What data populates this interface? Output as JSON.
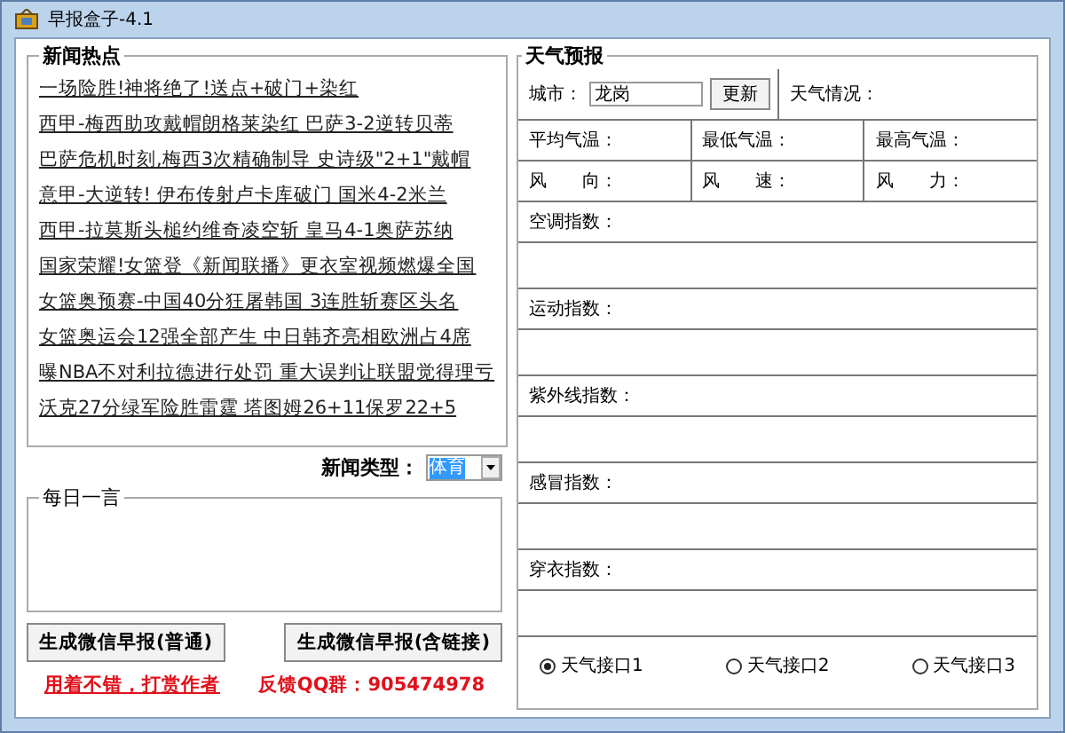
{
  "window": {
    "title": "早报盒子-4.1"
  },
  "news": {
    "title": "新闻热点",
    "items": [
      "一场险胜!神将绝了!送点+破门+染红",
      "西甲-梅西助攻戴帽朗格莱染红 巴萨3-2逆转贝蒂",
      "巴萨危机时刻,梅西3次精确制导 史诗级\"2+1\"戴帽",
      "意甲-大逆转! 伊布传射卢卡库破门 国米4-2米兰",
      "西甲-拉莫斯头槌约维奇凌空斩 皇马4-1奥萨苏纳",
      "国家荣耀!女篮登《新闻联播》更衣室视频燃爆全国",
      "女篮奥预赛-中国40分狂屠韩国 3连胜斩赛区头名",
      "女篮奥运会12强全部产生 中日韩齐亮相欧洲占4席",
      "曝NBA不对利拉德进行处罚 重大误判让联盟觉得理亏",
      "沃克27分绿军险胜雷霆 塔图姆26+11保罗22+5"
    ]
  },
  "news_type": {
    "label": "新闻类型：",
    "value": "体育"
  },
  "daily": {
    "title": "每日一言"
  },
  "buttons": [
    "生成微信早报(普通)",
    "生成微信早报(含链接)"
  ],
  "footer": [
    {
      "kind": "link",
      "text": "用着不错，打赏作者"
    },
    {
      "kind": "text",
      "text": "反馈QQ群：905474978"
    }
  ],
  "weather": {
    "title": "天气预报",
    "city_label": "城市：",
    "city_value": "龙岗",
    "update_button": "更新",
    "condition_label": "天气情况：",
    "stats": [
      [
        "平均气温：",
        "最低气温：",
        "最高气温："
      ],
      [
        "风　　向：",
        "风　　速：",
        "风　　力："
      ]
    ],
    "indices": [
      "空调指数：",
      "运动指数：",
      "紫外线指数：",
      "感冒指数：",
      "穿衣指数："
    ],
    "interfaces": [
      {
        "label": "天气接口1",
        "selected": true
      },
      {
        "label": "天气接口2",
        "selected": false
      },
      {
        "label": "天气接口3",
        "selected": false
      }
    ]
  }
}
